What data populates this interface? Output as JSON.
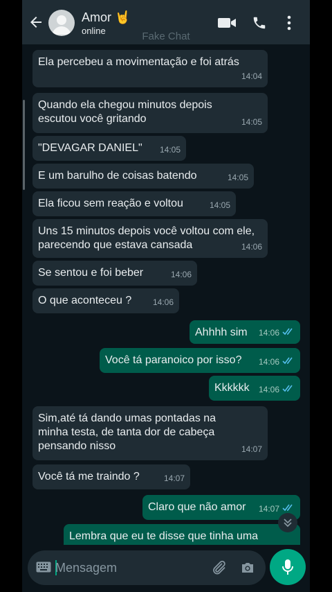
{
  "header": {
    "contact_name": "Amor 🤘",
    "status": "online",
    "overlay_label": "Fake Chat"
  },
  "icons": [
    "back-arrow-icon",
    "avatar",
    "video-call-icon",
    "phone-icon",
    "more-vert-icon",
    "double-check-icon",
    "chevron-down-icon",
    "keyboard-icon",
    "attach-icon",
    "camera-icon",
    "mic-icon"
  ],
  "messages": [
    {
      "side": "in",
      "text": "Ela percebeu a movimentação e foi atrás",
      "time": "14:04"
    },
    {
      "side": "in",
      "text": "Quando ela chegou minutos depois escutou você gritando",
      "time": "14:05"
    },
    {
      "side": "in",
      "text": "\"DEVAGAR DANIEL\"",
      "time": "14:05"
    },
    {
      "side": "in",
      "text": "E um barulho de coisas batendo",
      "time": "14:05"
    },
    {
      "side": "in",
      "text": "Ela ficou sem reação e voltou",
      "time": "14:05"
    },
    {
      "side": "in",
      "text": "Uns 15 minutos depois você voltou com ele, parecendo que estava cansada",
      "time": "14:06"
    },
    {
      "side": "in",
      "text": "Se sentou e foi beber",
      "time": "14:06"
    },
    {
      "side": "in",
      "text": "O que aconteceu ?",
      "time": "14:06"
    },
    {
      "side": "out",
      "text": "Ahhhh sim",
      "time": "14:06"
    },
    {
      "side": "out",
      "text": "Você tá paranoico por isso?",
      "time": "14:06"
    },
    {
      "side": "out",
      "text": "Kkkkkk",
      "time": "14:06"
    },
    {
      "side": "in",
      "text": "Sim,até tá dando umas pontadas na minha testa, de tanta dor de cabeça pensando nisso",
      "time": "14:07"
    },
    {
      "side": "in",
      "text": "Você tá me traindo ?",
      "time": "14:07"
    },
    {
      "side": "out",
      "text": "Claro que não amor",
      "time": "14:07"
    },
    {
      "side": "out",
      "text": "Lembra que eu te disse que tinha uma",
      "time": ""
    }
  ],
  "input": {
    "placeholder": "Mensagem"
  },
  "colors": {
    "background": "#0b141a",
    "incoming_bubble": "#1f2c34",
    "outgoing_bubble": "#005c4b",
    "accent": "#00a884",
    "read_ticks": "#53bdeb"
  }
}
